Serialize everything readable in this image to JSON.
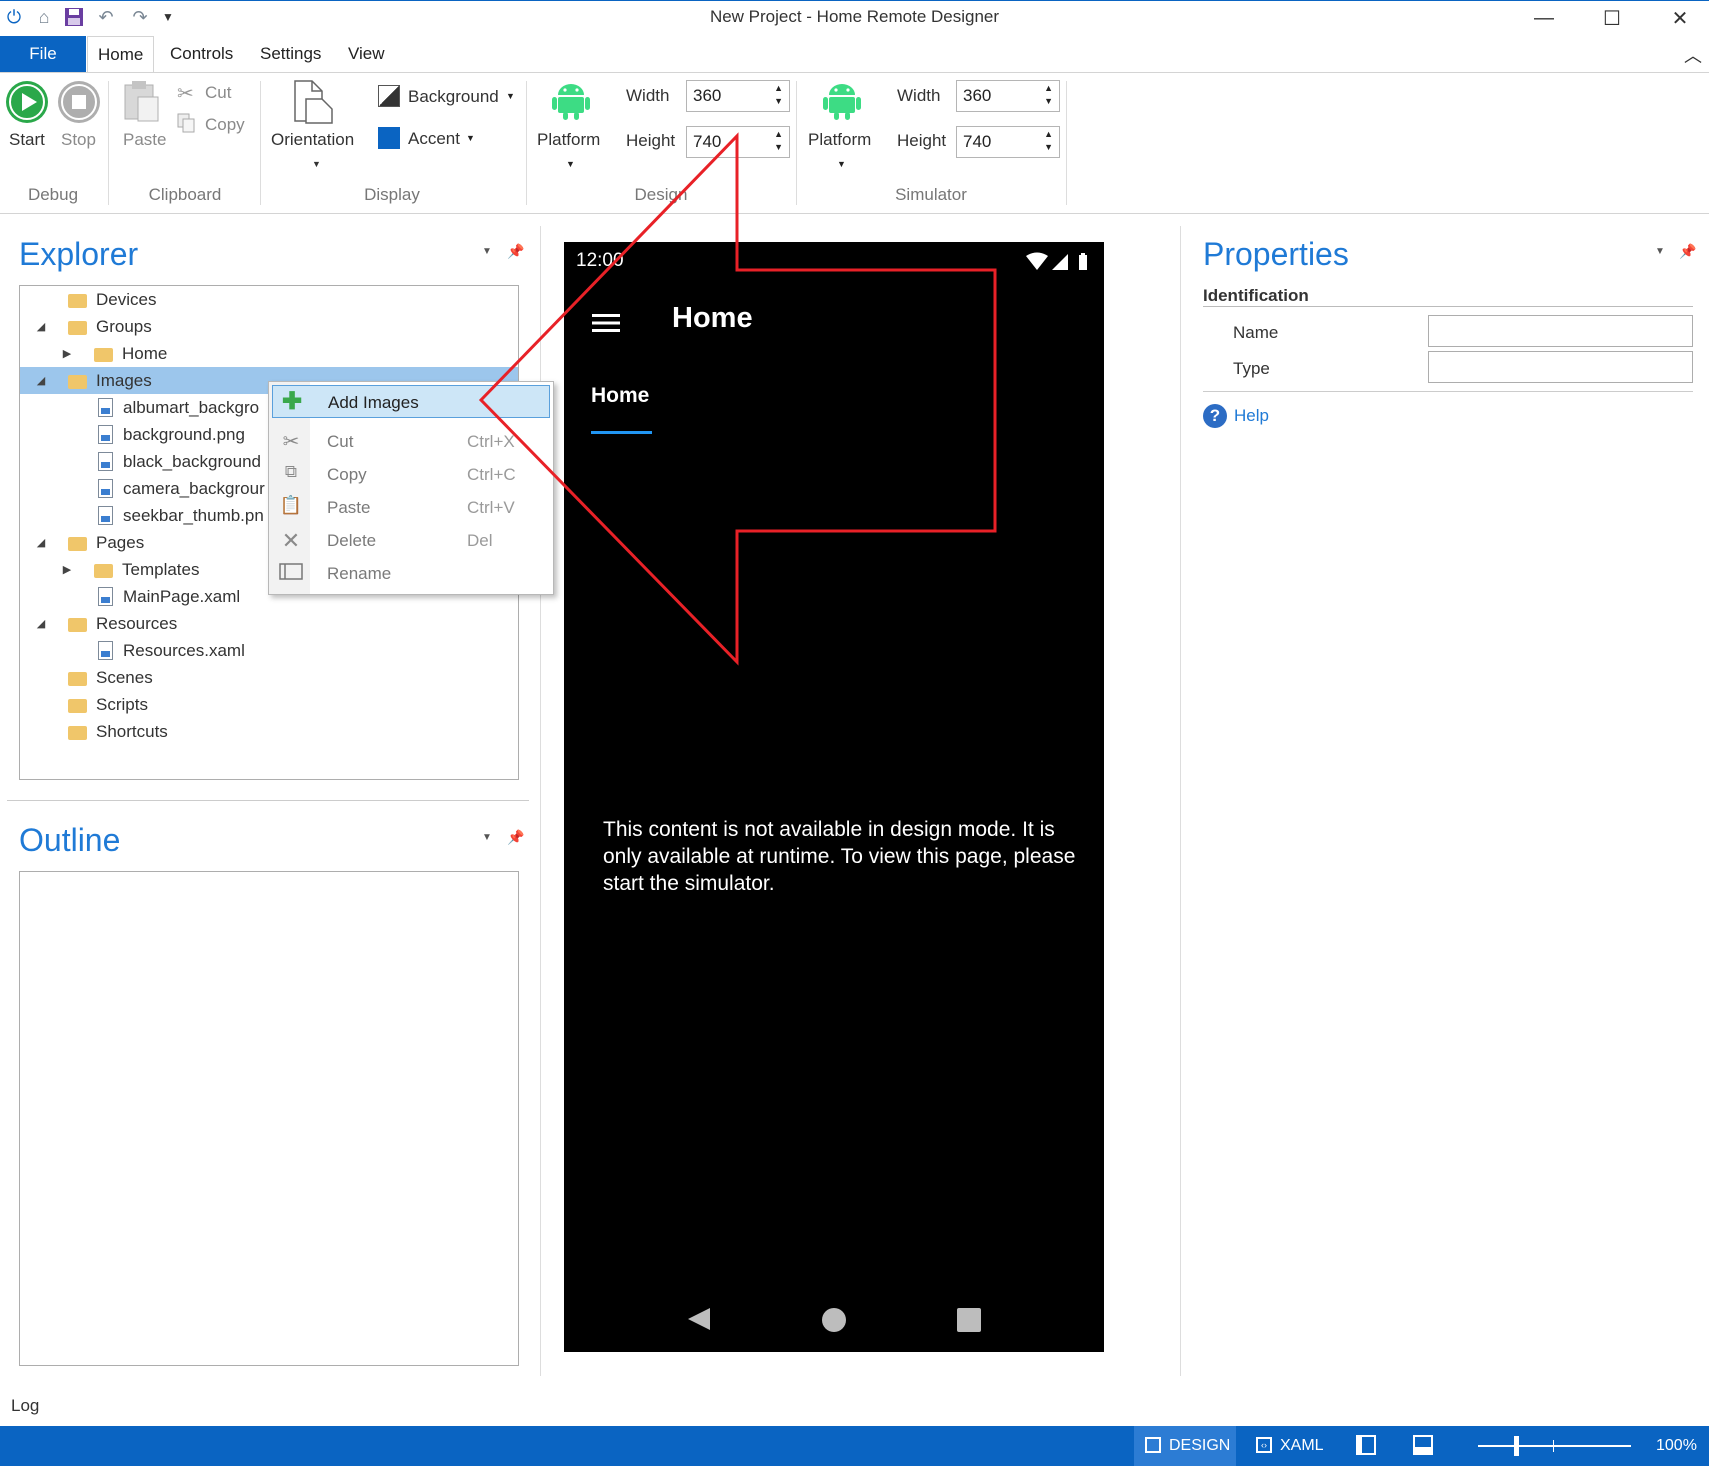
{
  "window": {
    "title": "New Project - Home Remote Designer"
  },
  "ribbon_tabs": [
    "File",
    "Home",
    "Controls",
    "Settings",
    "View"
  ],
  "ribbon": {
    "debug": {
      "start": "Start",
      "stop": "Stop",
      "group": "Debug"
    },
    "clipboard": {
      "paste": "Paste",
      "cut": "Cut",
      "copy": "Copy",
      "group": "Clipboard"
    },
    "display": {
      "orientation": "Orientation",
      "background": "Background",
      "accent": "Accent",
      "group": "Display",
      "accent_color": "#0a64c2"
    },
    "design": {
      "platform": "Platform",
      "width_label": "Width",
      "width_value": "360",
      "height_label": "Height",
      "height_value": "740",
      "group": "Design"
    },
    "simulator": {
      "platform": "Platform",
      "width_label": "Width",
      "width_value": "360",
      "height_label": "Height",
      "height_value": "740",
      "group": "Simulator"
    }
  },
  "explorer": {
    "title": "Explorer",
    "items": [
      {
        "label": "Devices"
      },
      {
        "label": "Groups"
      },
      {
        "label": "Home"
      },
      {
        "label": "Images"
      },
      {
        "label": "albumart_backgro"
      },
      {
        "label": "background.png"
      },
      {
        "label": "black_background"
      },
      {
        "label": "camera_backgrour"
      },
      {
        "label": "seekbar_thumb.pn"
      },
      {
        "label": "Pages"
      },
      {
        "label": "Templates"
      },
      {
        "label": "MainPage.xaml"
      },
      {
        "label": "Resources"
      },
      {
        "label": "Resources.xaml"
      },
      {
        "label": "Scenes"
      },
      {
        "label": "Scripts"
      },
      {
        "label": "Shortcuts"
      }
    ]
  },
  "context_menu": {
    "items": [
      {
        "label": "Add Images",
        "shortcut": ""
      },
      {
        "label": "Cut",
        "shortcut": "Ctrl+X"
      },
      {
        "label": "Copy",
        "shortcut": "Ctrl+C"
      },
      {
        "label": "Paste",
        "shortcut": "Ctrl+V"
      },
      {
        "label": "Delete",
        "shortcut": "Del"
      },
      {
        "label": "Rename",
        "shortcut": ""
      }
    ]
  },
  "outline": {
    "title": "Outline"
  },
  "phone": {
    "time": "12:00",
    "app_title": "Home",
    "tab": "Home",
    "message": "This content is not available in design mode. It is only available at runtime. To view this page, please start the simulator."
  },
  "properties": {
    "title": "Properties",
    "section": "Identification",
    "name_label": "Name",
    "type_label": "Type",
    "help": "Help"
  },
  "log": {
    "label": "Log"
  },
  "statusbar": {
    "design": "DESIGN",
    "xaml": "XAML",
    "zoom": "100%",
    "zoom_level": 0.25
  }
}
